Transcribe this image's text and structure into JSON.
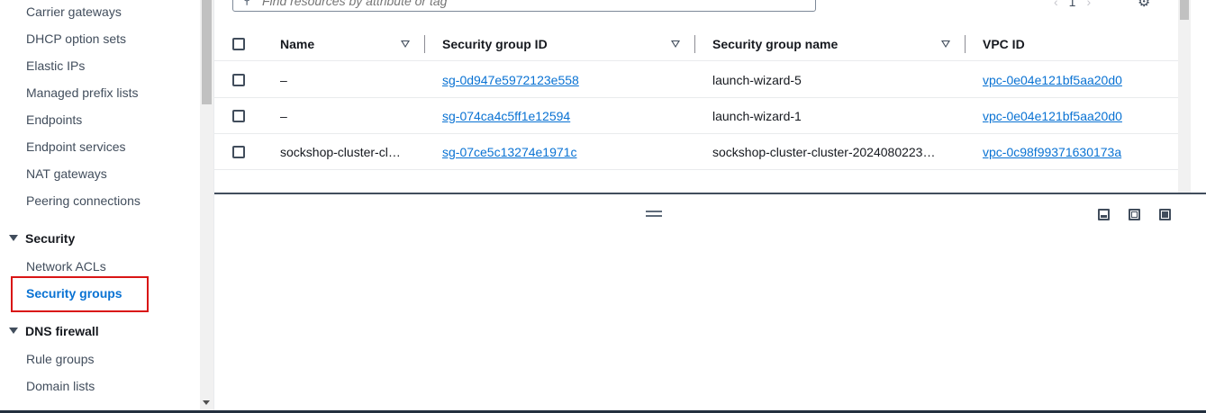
{
  "sidebar": {
    "items_top": [
      "Carrier gateways",
      "DHCP option sets",
      "Elastic IPs",
      "Managed prefix lists",
      "Endpoints",
      "Endpoint services",
      "NAT gateways",
      "Peering connections"
    ],
    "security_section": "Security",
    "security_items": [
      "Network ACLs",
      "Security groups"
    ],
    "dns_section": "DNS firewall",
    "dns_items": [
      "Rule groups",
      "Domain lists"
    ],
    "active_item": "Security groups",
    "highlight_color": "#d91515"
  },
  "search": {
    "placeholder": "Find resources by attribute or tag",
    "value": ""
  },
  "pager": {
    "current_page": "1"
  },
  "table": {
    "headers": {
      "name": "Name",
      "sg_id": "Security group ID",
      "sg_name": "Security group name",
      "vpc_id": "VPC ID"
    },
    "rows": [
      {
        "name": "–",
        "sg_id": "sg-0d947e5972123e558",
        "sg_name": "launch-wizard-5",
        "vpc_id": "vpc-0e04e121bf5aa20d0"
      },
      {
        "name": "–",
        "sg_id": "sg-074ca4c5ff1e12594",
        "sg_name": "launch-wizard-1",
        "vpc_id": "vpc-0e04e121bf5aa20d0"
      },
      {
        "name": "sockshop-cluster-cl…",
        "sg_id": "sg-07ce5c13274e1971c",
        "sg_name": "sockshop-cluster-cluster-2024080223…",
        "vpc_id": "vpc-0c98f99371630173a"
      }
    ]
  },
  "colors": {
    "link": "#0972d3",
    "active_nav": "#0972d3",
    "text": "#16191f"
  }
}
